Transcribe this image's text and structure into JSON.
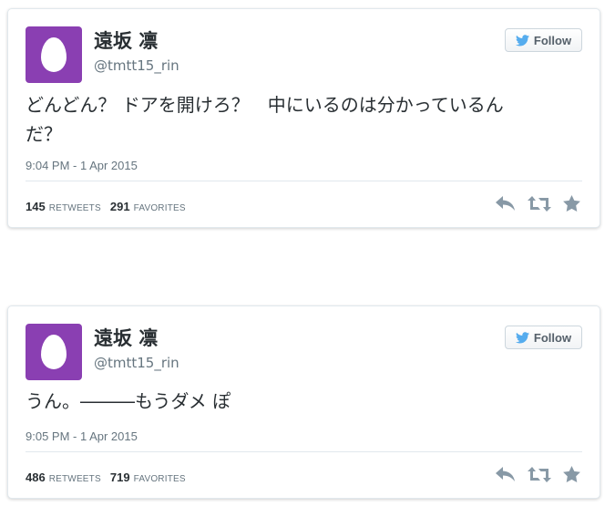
{
  "tweets": [
    {
      "display_name": "遠坂 凛",
      "handle": "@tmtt15_rin",
      "follow_label": "Follow",
      "text": "どんどん？ ドアを開けろ？　中にいるのは分かっているん\nだ？",
      "timestamp": "9:04 PM - 1 Apr 2015",
      "retweets_count": "145",
      "retweets_label": "RETWEETS",
      "favorites_count": "291",
      "favorites_label": "FAVORITES",
      "icons": [
        "reply-icon",
        "retweet-icon",
        "favorite-star-icon"
      ]
    },
    {
      "display_name": "遠坂 凛",
      "handle": "@tmtt15_rin",
      "follow_label": "Follow",
      "text": "うん。―――もうダメ ぽ",
      "timestamp": "9:05 PM - 1 Apr 2015",
      "retweets_count": "486",
      "retweets_label": "RETWEETS",
      "favorites_count": "719",
      "favorites_label": "FAVORITES",
      "icons": [
        "reply-icon",
        "retweet-icon",
        "favorite-star-icon"
      ]
    }
  ],
  "colors": {
    "avatar": "#8a3fb2",
    "twitter_blue": "#55acee",
    "text": "#292f33",
    "muted": "#66757f",
    "action_icon": "#8899a6"
  }
}
